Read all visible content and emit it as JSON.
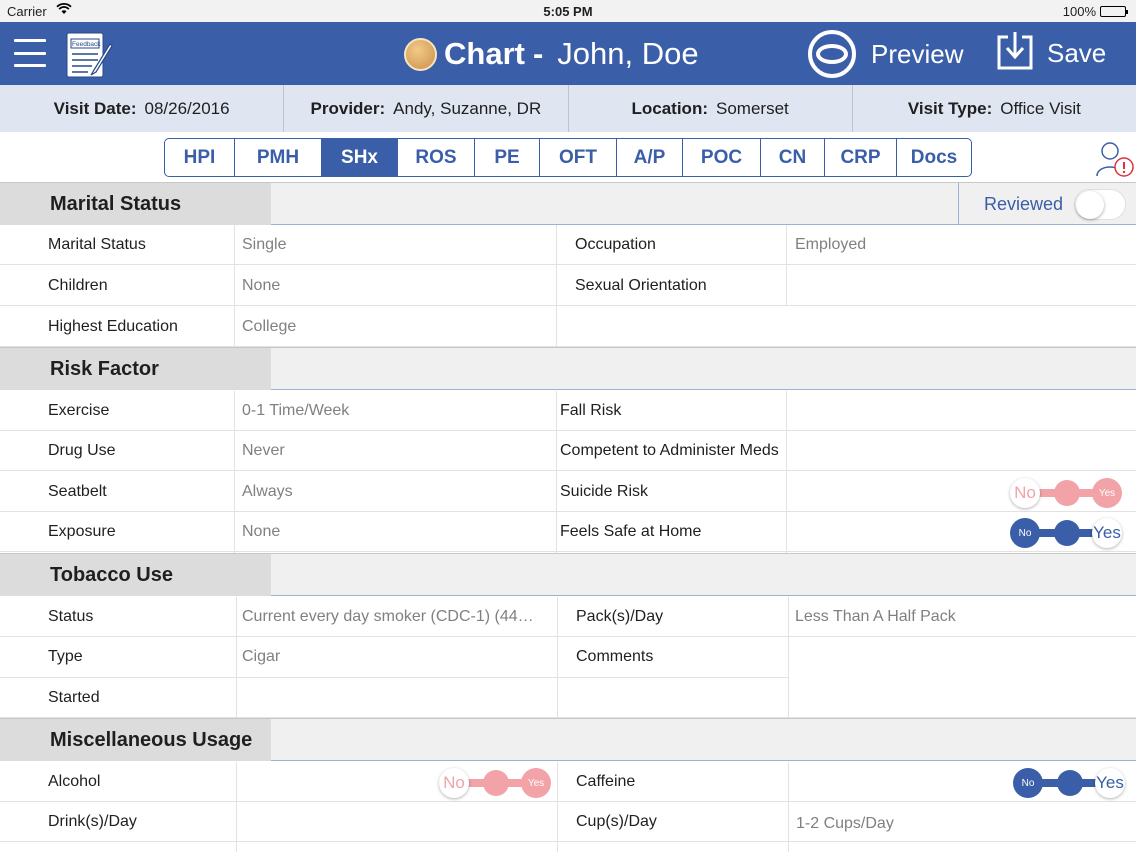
{
  "status_bar": {
    "carrier": "Carrier",
    "time": "5:05 PM",
    "battery": "100%"
  },
  "nav": {
    "feedback_label": "Feedback",
    "title": "Chart",
    "separator": "-",
    "patient": "John, Doe",
    "preview": "Preview",
    "save": "Save"
  },
  "visit_info": [
    {
      "key": "Visit Date:",
      "value": "08/26/2016"
    },
    {
      "key": "Provider:",
      "value": "Andy, Suzanne, DR"
    },
    {
      "key": "Location:",
      "value": "Somerset"
    },
    {
      "key": "Visit Type:",
      "value": "Office Visit"
    }
  ],
  "tabs": [
    {
      "label": "HPI",
      "active": false
    },
    {
      "label": "PMH",
      "active": false
    },
    {
      "label": "SHx",
      "active": true
    },
    {
      "label": "ROS",
      "active": false
    },
    {
      "label": "PE",
      "active": false
    },
    {
      "label": "OFT",
      "active": false
    },
    {
      "label": "A/P",
      "active": false
    },
    {
      "label": "POC",
      "active": false
    },
    {
      "label": "CN",
      "active": false
    },
    {
      "label": "CRP",
      "active": false
    },
    {
      "label": "Docs",
      "active": false
    }
  ],
  "colors": {
    "brand": "#3a5ea8",
    "toggle_no": "#f2a3a8",
    "toggle_yes": "#3a5ea8"
  },
  "marital": {
    "title": "Marital Status",
    "reviewed_label": "Reviewed",
    "reviewed": false,
    "rows": [
      {
        "label": "Marital Status",
        "value": "Single",
        "label2": "Occupation",
        "value2": "Employed"
      },
      {
        "label": "Children",
        "value": "None",
        "label2": "Sexual Orientation",
        "value2": ""
      },
      {
        "label": "Highest Education",
        "value": "College"
      }
    ]
  },
  "risk": {
    "title": "Risk Factor",
    "rows": [
      {
        "label": "Exercise",
        "value": "0-1 Time/Week",
        "label2": "Fall Risk",
        "value2": ""
      },
      {
        "label": "Drug Use",
        "value": "Never",
        "label2": "Competent to Administer Meds",
        "value2": ""
      },
      {
        "label": "Seatbelt",
        "value": "Always",
        "label2": "Suicide Risk",
        "toggle": {
          "no": "No",
          "yes": "Yes",
          "state": "No"
        }
      },
      {
        "label": "Exposure",
        "value": "None",
        "label2": "Feels Safe at Home",
        "toggle": {
          "no": "No",
          "yes": "Yes",
          "state": "Yes"
        }
      }
    ]
  },
  "tobacco": {
    "title": "Tobacco Use",
    "rows": [
      {
        "label": "Status",
        "value": "Current every day smoker  (CDC-1) (44…",
        "label2": "Pack(s)/Day",
        "value2": "Less Than A Half Pack"
      },
      {
        "label": "Type",
        "value": "Cigar",
        "label2": "Comments",
        "value2": ""
      },
      {
        "label": "Started",
        "value": ""
      }
    ]
  },
  "misc": {
    "title": "Miscellaneous Usage",
    "rows": [
      {
        "label": "Alcohol",
        "toggle": {
          "no": "No",
          "yes": "Yes",
          "state": "No"
        },
        "label2": "Caffeine",
        "toggle2": {
          "no": "No",
          "yes": "Yes",
          "state": "Yes"
        }
      },
      {
        "label": "Drink(s)/Day",
        "value": "",
        "label2": "Cup(s)/Day",
        "value2": "1-2 Cups/Day"
      }
    ]
  }
}
